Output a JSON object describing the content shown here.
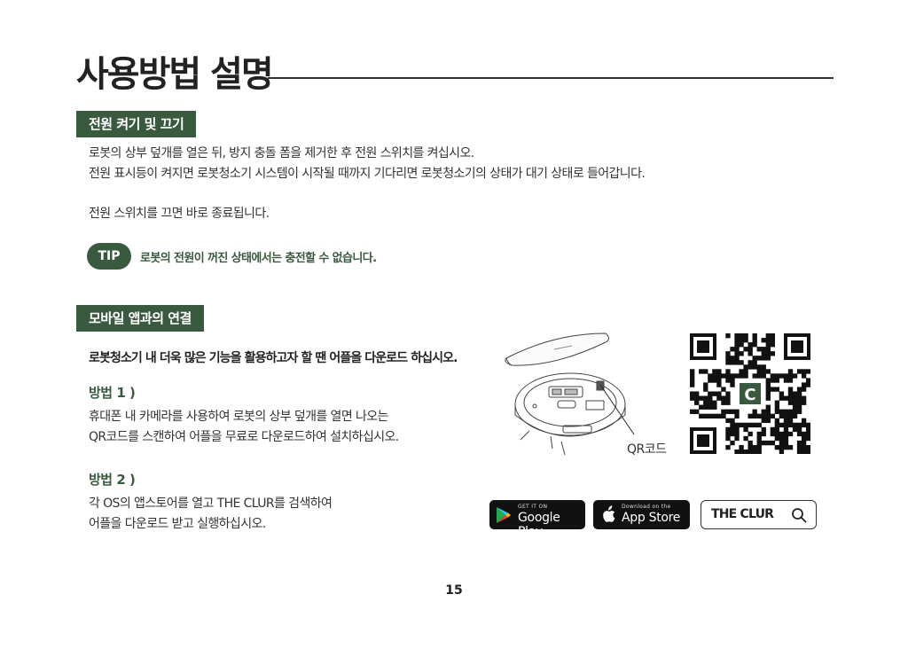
{
  "title": "사용방법 설명",
  "section1": {
    "label": "전원 켜기 및 끄기",
    "line1": "로봇의 상부 덮개를 열은 뒤, 방지 충돌 폼을 제거한 후 전원 스위치를 켜십시오.",
    "line2": "전원 표시등이 켜지면 로봇청소기 시스템이 시작될 때까지 기다리면 로봇청소기의 상태가 대기 상태로 들어갑니다.",
    "line3": "전원 스위치를 끄면 바로 종료됩니다.",
    "tip_badge": "TIP",
    "tip_text": "로봇의 전원이 꺼진 상태에서는 충전할 수 없습니다."
  },
  "section2": {
    "label": "모바일 앱과의 연결",
    "intro": "로봇청소기 내 더욱 많은 기능을 활용하고자 할 땐 어플을 다운로드 하십시오.",
    "method1_title": "방법 1 )",
    "method1_line1": "휴대폰 내 카메라를 사용하여 로봇의 상부 덮개를 열면 나오는",
    "method1_line2": "QR코드를 스캔하여 어플을 무료로 다운로드하여 설치하십시오.",
    "qr_label": "QR코드",
    "qr_center_letter": "C",
    "method2_title": "방법 2 )",
    "method2_line1": "각 OS의 앱스토어를 열고 THE CLUR를 검색하여",
    "method2_line2": "어플을 다운로드 받고 실행하십시오."
  },
  "badges": {
    "google_small": "GET IT ON",
    "google_big": "Google Play",
    "apple_small": "Download on the",
    "apple_big": "App Store",
    "search_brand": "THE CLUR"
  },
  "page_number": "15",
  "colors": {
    "accent": "#3a5a40",
    "text": "#333333",
    "badge_bg": "#111111"
  }
}
